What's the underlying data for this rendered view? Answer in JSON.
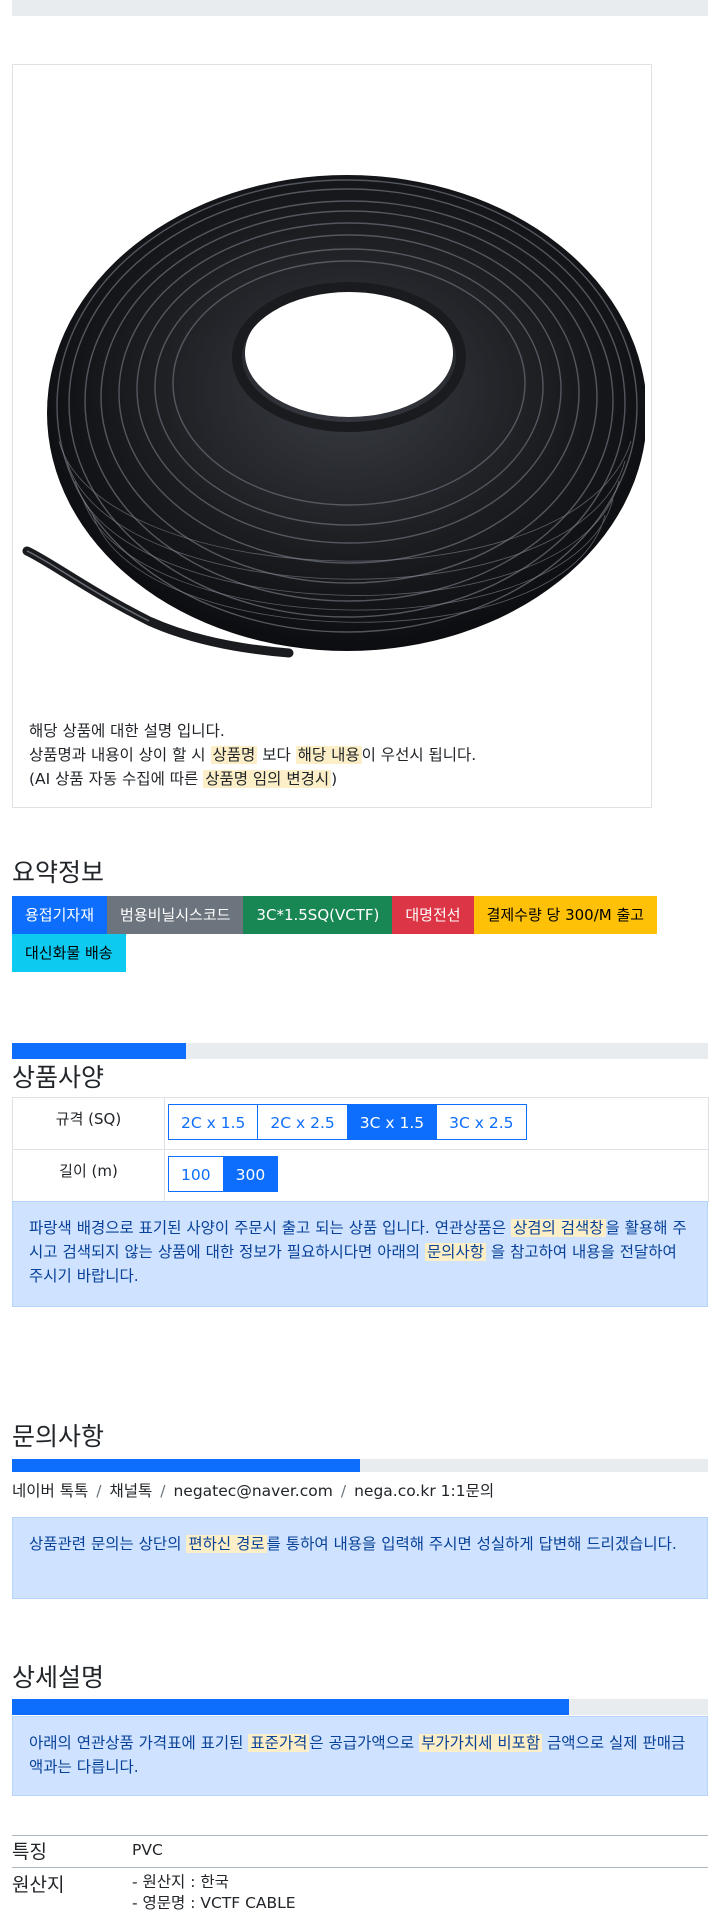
{
  "product": {
    "desc_line1": "해당 상품에 대한 설명 입니다.",
    "desc_line2_a": "상품명과 내용이 상이 할 시 ",
    "desc_line2_mark1": "상품명",
    "desc_line2_b": " 보다 ",
    "desc_line2_mark2": "해당 내용",
    "desc_line2_c": "이 우선시 됩니다.",
    "desc_line3_a": "(AI 상품 자동 수집에 따른 ",
    "desc_line3_mark": "상품명 임의 변경시",
    "desc_line3_b": ")"
  },
  "summary": {
    "title": "요약정보",
    "badges": [
      {
        "label": "용접기자재",
        "color": "#0d6efd"
      },
      {
        "label": "범용비닐시스코드",
        "color": "#6c757d"
      },
      {
        "label": "3C*1.5SQ(VCTF)",
        "color": "#198754"
      },
      {
        "label": "대명전선",
        "color": "#dc3545"
      },
      {
        "label": "결제수량 당 300/M 출고",
        "color": "#ffc107"
      },
      {
        "label": "대신화물 배송",
        "color": "#0dcaf0"
      }
    ]
  },
  "spec": {
    "progress": 0.25,
    "title": "상품사양",
    "rows": [
      {
        "label": "규격 (SQ)",
        "options": [
          "2C x 1.5",
          "2C x 2.5",
          "3C x 1.5",
          "3C x 2.5"
        ],
        "selected": "3C x 1.5"
      },
      {
        "label": "길이 (m)",
        "options": [
          "100",
          "300"
        ],
        "selected": "300"
      }
    ],
    "notice_a": "파랑색 배경으로 표기된 사양이 주문시 출고 되는 상품 입니다. 연관상품은 ",
    "notice_mark1": "상겸의 검색창",
    "notice_b": "을 활용해 주시고 검색되지 않는 상품에 대한 정보가 필요하시다면 아래의 ",
    "notice_mark2": "문의사항",
    "notice_c": " 을 참고하여 내용을 전달하여 주시기 바랍니다."
  },
  "inquiry": {
    "title": "문의사항",
    "progress": 0.5,
    "channels": [
      "네이버 톡톡",
      "채널톡",
      "negatec@naver.com",
      "nega.co.kr 1:1문의"
    ],
    "separator": "/",
    "notice_a": "상품관련 문의는 상단의 ",
    "notice_mark": "편하신 경로",
    "notice_b": "를 통하여 내용을 입력해 주시면 성실하게 답변해 드리겠습니다."
  },
  "detail": {
    "title": "상세설명",
    "progress": 0.8,
    "notice_a": "아래의 연관상품 가격표에 표기된 ",
    "notice_mark1": "표준가격",
    "notice_b": "은 공급가액으로 ",
    "notice_mark2": "부가가치세 비포함",
    "notice_c": " 금액으로 실제 판매금액과는 다릅니다."
  },
  "features": [
    {
      "key": "특징",
      "value_lines": [
        "PVC"
      ]
    },
    {
      "key": "원산지",
      "value_lines": [
        "- 원산지 : 한국",
        "- 영문명 : VCTF CABLE"
      ]
    }
  ]
}
